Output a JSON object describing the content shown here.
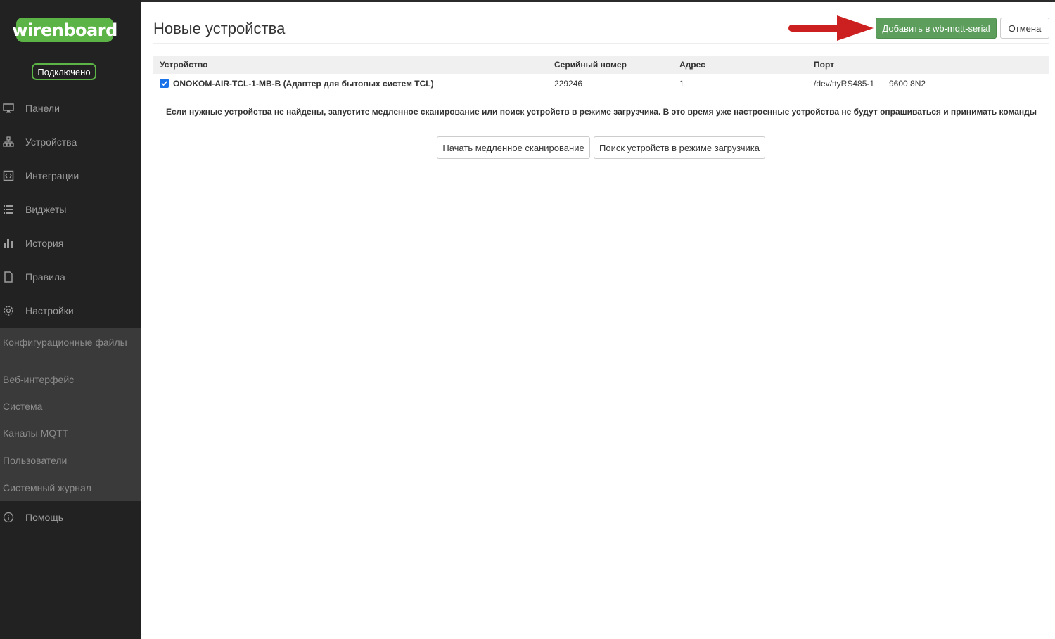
{
  "brand": {
    "logo_text": "wirenboard",
    "status": "Подключено",
    "accent": "#5db446"
  },
  "nav": {
    "items": [
      {
        "label": "Панели",
        "icon": "monitor-icon"
      },
      {
        "label": "Устройства",
        "icon": "devices-icon"
      },
      {
        "label": "Интеграции",
        "icon": "integrations-icon"
      },
      {
        "label": "Виджеты",
        "icon": "list-icon"
      },
      {
        "label": "История",
        "icon": "bar-chart-icon"
      },
      {
        "label": "Правила",
        "icon": "file-icon"
      },
      {
        "label": "Настройки",
        "icon": "gear-icon"
      }
    ],
    "settings_submenu": [
      "Конфигурационные файлы",
      "Веб-интерфейс",
      "Система",
      "Каналы MQTT",
      "Пользователи",
      "Системный журнал"
    ],
    "help": {
      "label": "Помощь",
      "icon": "info-icon"
    }
  },
  "page": {
    "title": "Новые устройства",
    "add_button": "Добавить в wb-mqtt-serial",
    "cancel_button": "Отмена"
  },
  "table": {
    "headers": [
      "Устройство",
      "Серийный номер",
      "Адрес",
      "Порт"
    ],
    "rows": [
      {
        "checked": true,
        "device": "ONOKOM-AIR-TCL-1-MB-B (Адаптер для бытовых систем TCL)",
        "serial": "229246",
        "address": "1",
        "port": "/dev/ttyRS485-1",
        "port_settings": "9600 8N2"
      }
    ]
  },
  "notice": "Если нужные устройства не найдены, запустите медленное сканирование или поиск устройств в режиме загрузчика. В это время уже настроенные устройства не будут опрашиваться и принимать команды",
  "scan_buttons": {
    "slow_scan": "Начать медленное сканирование",
    "bootloader_scan": "Поиск устройств в режиме загрузчика"
  },
  "colors": {
    "sidebar_bg": "#222222",
    "submenu_bg": "#3a3a3a",
    "primary_btn": "#5d9e5d",
    "arrow": "#cc1f1f"
  }
}
